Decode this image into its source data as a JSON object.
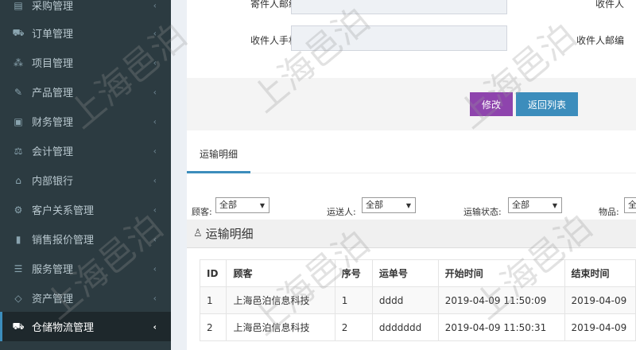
{
  "sidebar": {
    "items": [
      {
        "label": "采购管理",
        "icon": "cart-box-icon"
      },
      {
        "label": "订单管理",
        "icon": "cart-icon"
      },
      {
        "label": "项目管理",
        "icon": "cubes-icon"
      },
      {
        "label": "产品管理",
        "icon": "edit-icon"
      },
      {
        "label": "财务管理",
        "icon": "money-icon"
      },
      {
        "label": "会计管理",
        "icon": "scale-icon"
      },
      {
        "label": "内部银行",
        "icon": "bank-icon"
      },
      {
        "label": "客户关系管理",
        "icon": "cogs-icon"
      },
      {
        "label": "销售报价管理",
        "icon": "bar-chart-icon"
      },
      {
        "label": "服务管理",
        "icon": "list-icon"
      },
      {
        "label": "资产管理",
        "icon": "diamond-icon"
      },
      {
        "label": "仓储物流管理",
        "icon": "truck-icon"
      }
    ],
    "chevron": "‹",
    "active_color": "#3c8dbc"
  },
  "form": {
    "sender_email_label": "寄件人邮编",
    "receiver_label": "收件人",
    "receiver_phone_label": "收件人手机",
    "receiver_email_label": "收件人邮编"
  },
  "buttons": {
    "edit": "修改",
    "back": "返回列表",
    "edit_color": "#8e44ad",
    "back_color": "#3c8dbc"
  },
  "tabs": {
    "active": "运输明细"
  },
  "filters": {
    "customer_label": "顾客:",
    "customer_value": "全部",
    "carrier_label": "运送人:",
    "carrier_value": "全部",
    "status_label": "运输状态:",
    "status_value": "全部",
    "item_label": "物品:",
    "item_value": "全"
  },
  "section": {
    "title": "运输明细"
  },
  "table": {
    "headers": [
      "ID",
      "顾客",
      "序号",
      "运单号",
      "开始时间",
      "结束时间"
    ],
    "rows": [
      [
        "1",
        "上海邑泊信息科技",
        "1",
        "dddd",
        "2019-04-09 11:50:09",
        "2019-04-09"
      ],
      [
        "2",
        "上海邑泊信息科技",
        "2",
        "ddddddd",
        "2019-04-09 11:50:31",
        "2019-04-09"
      ]
    ]
  },
  "watermark": {
    "text": "上海邑泊"
  }
}
